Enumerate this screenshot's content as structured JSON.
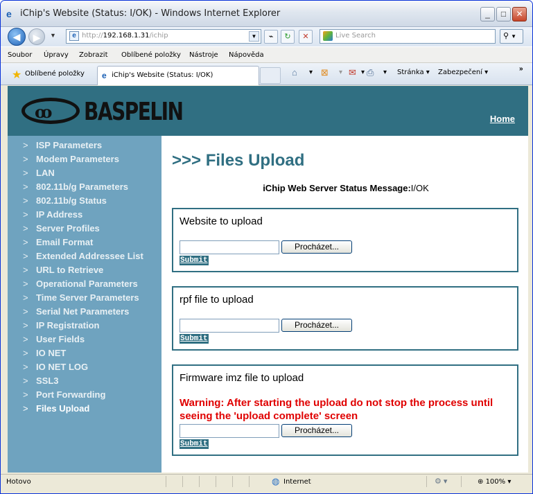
{
  "window": {
    "title": "iChip's Website (Status: I/OK) - Windows Internet Explorer",
    "min_glyph": "_",
    "max_glyph": "□",
    "close_glyph": "✕"
  },
  "address_bar": {
    "url_prefix": "http://",
    "url_host": "192.168.1.31",
    "url_path": "/ichip",
    "search_placeholder": "Live Search"
  },
  "menu": [
    "Soubor",
    "Úpravy",
    "Zobrazit",
    "Oblíbené položky",
    "Nástroje",
    "Nápověda"
  ],
  "favorites_bar": {
    "favorites_label": "Oblíbené položky",
    "tab_label": "iChip's Website (Status: I/OK)",
    "page_menu": "Stránka",
    "safety_menu": "Zabezpečení",
    "overflow": "»"
  },
  "site": {
    "brand": "BASPELIN",
    "home_link": "Home",
    "sidebar_arrow": ">",
    "sidebar": [
      "ISP Parameters",
      "Modem Parameters",
      "LAN",
      "802.11b/g Parameters",
      "802.11b/g Status",
      "IP Address",
      "Server Profiles",
      "Email Format",
      "Extended Addressee List",
      "URL to Retrieve",
      "Operational Parameters",
      "Time Server Parameters",
      "Serial Net Parameters",
      "IP Registration",
      "User Fields",
      "IO NET",
      "IO NET LOG",
      "SSL3",
      "Port Forwarding",
      "Files Upload"
    ],
    "active_item": "Files Upload"
  },
  "main": {
    "title": ">>> Files Upload",
    "status_label": "iChip Web Server Status Message:",
    "status_value": "I/OK",
    "browse_label": "Procházet...",
    "submit_label": "Submit",
    "website_box_title": "Website to upload",
    "rpf_box_title": "rpf file to upload",
    "firmware_box_title": "Firmware imz file to upload",
    "warning": "Warning: After starting the upload do not stop the process until seeing the 'upload complete' screen"
  },
  "status_bar": {
    "status": "Hotovo",
    "zone": "Internet",
    "zoom": "100%"
  }
}
